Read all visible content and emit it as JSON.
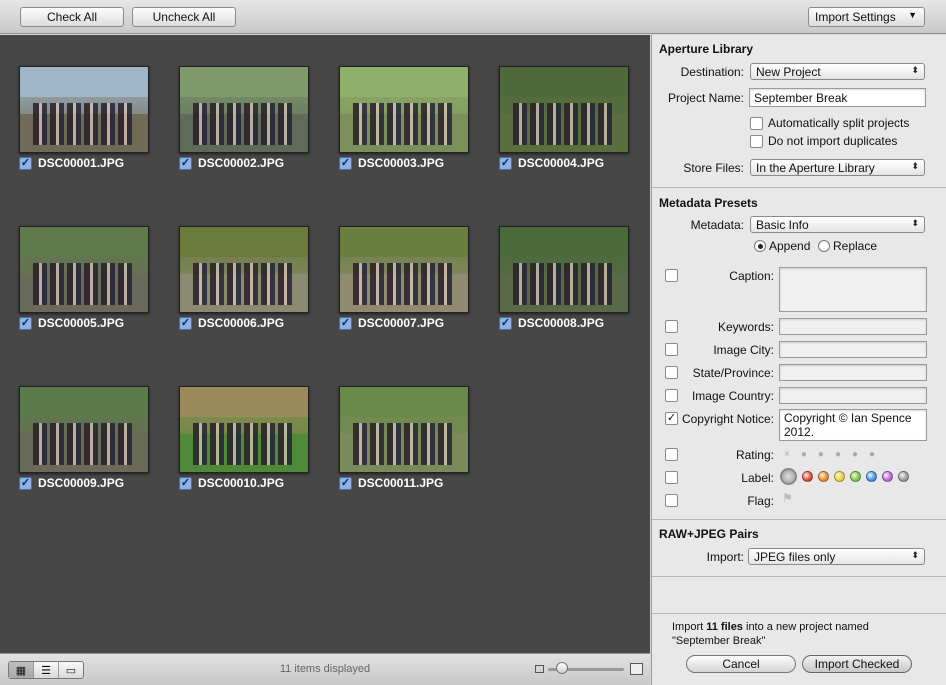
{
  "toolbar": {
    "check_all": "Check All",
    "uncheck_all": "Uncheck All",
    "import_settings": "Import Settings"
  },
  "photos": [
    {
      "filename": "DSC00001.JPG",
      "checked": true,
      "sky": "#9fb6c8",
      "ground": "#6f6a55"
    },
    {
      "filename": "DSC00002.JPG",
      "checked": true,
      "sky": "#7f9a6a",
      "ground": "#5f6a58"
    },
    {
      "filename": "DSC00003.JPG",
      "checked": true,
      "sky": "#8fb06a",
      "ground": "#7a8f5a"
    },
    {
      "filename": "DSC00004.JPG",
      "checked": true,
      "sky": "#4f6a3a",
      "ground": "#5a6f40"
    },
    {
      "filename": "DSC00005.JPG",
      "checked": true,
      "sky": "#5f7a4a",
      "ground": "#6a6a5a"
    },
    {
      "filename": "DSC00006.JPG",
      "checked": true,
      "sky": "#6a7a3a",
      "ground": "#8a8a70"
    },
    {
      "filename": "DSC00007.JPG",
      "checked": true,
      "sky": "#6a7f3f",
      "ground": "#8f8a70"
    },
    {
      "filename": "DSC00008.JPG",
      "checked": true,
      "sky": "#4a6a3a",
      "ground": "#5a6a48"
    },
    {
      "filename": "DSC00009.JPG",
      "checked": true,
      "sky": "#5a7a4a",
      "ground": "#6a6a58"
    },
    {
      "filename": "DSC00010.JPG",
      "checked": true,
      "sky": "#9a8a5a",
      "ground": "#4f8a3a"
    },
    {
      "filename": "DSC00011.JPG",
      "checked": true,
      "sky": "#6a8a4a",
      "ground": "#7a8a5a"
    }
  ],
  "bottom_bar": {
    "items_displayed": "11 items displayed"
  },
  "panel": {
    "library": {
      "title": "Aperture Library",
      "destination_label": "Destination:",
      "destination_value": "New Project",
      "project_name_label": "Project Name:",
      "project_name_value": "September Break",
      "auto_split_label": "Automatically split projects",
      "auto_split_checked": false,
      "no_duplicates_label": "Do not import duplicates",
      "no_duplicates_checked": false,
      "store_files_label": "Store Files:",
      "store_files_value": "In the Aperture Library"
    },
    "metadata": {
      "title": "Metadata Presets",
      "metadata_label": "Metadata:",
      "metadata_value": "Basic Info",
      "append_label": "Append",
      "replace_label": "Replace",
      "mode": "append",
      "fields": {
        "caption": {
          "label": "Caption:",
          "value": "",
          "checked": false
        },
        "keywords": {
          "label": "Keywords:",
          "value": "",
          "checked": false
        },
        "city": {
          "label": "Image City:",
          "value": "",
          "checked": false
        },
        "state": {
          "label": "State/Province:",
          "value": "",
          "checked": false
        },
        "country": {
          "label": "Image Country:",
          "value": "",
          "checked": false
        },
        "copyright": {
          "label": "Copyright Notice:",
          "value": "Copyright © Ian Spence 2012.",
          "checked": true
        },
        "rating": {
          "label": "Rating:",
          "checked": false,
          "reject_glyph": "×",
          "value": 0
        },
        "color_label": {
          "label": "Label:",
          "checked": false,
          "colors": [
            "#e2453a",
            "#f08a2a",
            "#e8d430",
            "#7ac843",
            "#3f8fe8",
            "#b865d8",
            "#9a9a9a"
          ]
        },
        "flag": {
          "label": "Flag:",
          "checked": false
        }
      }
    },
    "raw_jpeg": {
      "title": "RAW+JPEG Pairs",
      "import_label": "Import:",
      "import_value": "JPEG files only"
    },
    "summary": {
      "prefix": "Import ",
      "count": "11 files",
      "suffix": " into a new project named",
      "project": "\"September Break\""
    },
    "cancel": "Cancel",
    "import_checked": "Import Checked"
  }
}
